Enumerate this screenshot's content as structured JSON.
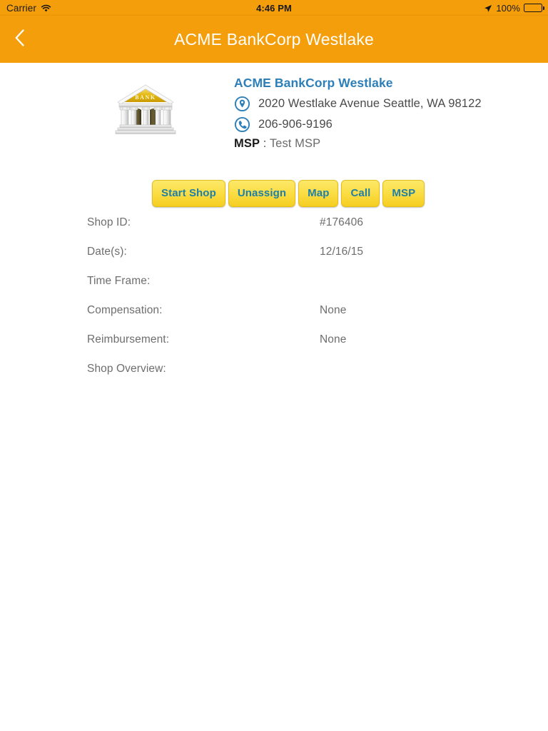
{
  "status_bar": {
    "carrier": "Carrier",
    "wifi_icon": "wifi-icon",
    "time": "4:46 PM",
    "location_icon": "location-arrow-icon",
    "battery_percent": "100%",
    "battery_icon": "battery-full-icon"
  },
  "nav_bar": {
    "back_icon": "chevron-left-icon",
    "title": "ACME BankCorp Westlake",
    "background_color": "#F59E0B",
    "title_color": "#FFFFFF"
  },
  "organization": {
    "logo_icon": "bank-building-icon",
    "logo_label": "BANK",
    "name": "ACME BankCorp Westlake",
    "name_color": "#2C7FB8",
    "address_icon": "location-pin-icon",
    "address": "2020 Westlake Avenue Seattle, WA 98122",
    "phone_icon": "phone-icon",
    "phone": "206-906-9196",
    "msp_key": "MSP",
    "msp_separator": ":",
    "msp_value": "Test MSP"
  },
  "action_buttons": {
    "background_color": "#FBDD45",
    "text_color": "#1E7FA8",
    "items": [
      {
        "label": "Start Shop",
        "name": "start-shop-button"
      },
      {
        "label": "Unassign",
        "name": "unassign-button"
      },
      {
        "label": "Map",
        "name": "map-button"
      },
      {
        "label": "Call",
        "name": "call-button"
      },
      {
        "label": "MSP",
        "name": "msp-button"
      }
    ]
  },
  "details": [
    {
      "label": "Shop ID:",
      "value": "#176406"
    },
    {
      "label": "Date(s):",
      "value": "12/16/15"
    },
    {
      "label": "Time Frame:",
      "value": ""
    },
    {
      "label": "Compensation:",
      "value": "None"
    },
    {
      "label": "Reimbursement:",
      "value": "None"
    },
    {
      "label": "Shop Overview:",
      "value": ""
    }
  ]
}
